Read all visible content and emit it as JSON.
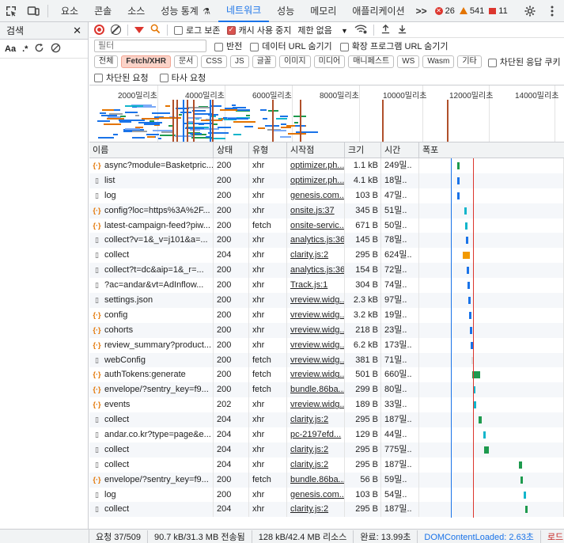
{
  "toolbar": {
    "tabs": [
      "요소",
      "콘솔",
      "소스",
      "성능 통계",
      "네트워크",
      "성능",
      "메모리",
      "애플리케이션"
    ],
    "pin": "⚗",
    "more": ">>",
    "errors": "26",
    "warnings": "541",
    "issues": "11"
  },
  "left": {
    "title": "검색",
    "close": "✕",
    "match_case": "Aa",
    "regex": ".*"
  },
  "net": {
    "preserve_log": "로그 보존",
    "disable_cache": "캐시 사용 중지",
    "throttle": "제한 없음",
    "filter_placeholder": "필터",
    "invert": "반전",
    "hide_data_url": "데이터 URL 숨기기",
    "hide_ext_url": "확장 프로그램 URL 숨기기",
    "chips": [
      "전체",
      "Fetch/XHR",
      "문서",
      "CSS",
      "JS",
      "글꼴",
      "이미지",
      "미디어",
      "매니페스트",
      "WS",
      "Wasm",
      "기타"
    ],
    "blocked_cookies": "차단된 응답 쿠키",
    "blocked_requests": "차단된 요청",
    "third_party": "타사 요청"
  },
  "overview": {
    "ticks": [
      "2000밀리초",
      "4000밀리초",
      "6000밀리초",
      "8000밀리초",
      "10000밀리초",
      "12000밀리초",
      "14000밀리초"
    ]
  },
  "columns": [
    "이름",
    "상태",
    "유형",
    "시작점",
    "크기",
    "시간",
    "폭포"
  ],
  "rows": [
    {
      "name": "async?module=Basketpric...",
      "status": "200",
      "type": "xhr",
      "init": "optimizer.ph...",
      "size": "1.1 kB",
      "time": "249밀..",
      "icon": "xhr",
      "wf_start": 0.26,
      "wf_len": 0.02,
      "wf_color": "#1e9a4e"
    },
    {
      "name": "list",
      "status": "200",
      "type": "xhr",
      "init": "optimizer.ph...",
      "size": "4.1 kB",
      "time": "18밀..",
      "icon": "doc",
      "wf_start": 0.26,
      "wf_len": 0.01,
      "wf_color": "#1a73e8"
    },
    {
      "name": "log",
      "status": "200",
      "type": "xhr",
      "init": "genesis.com...",
      "size": "103 B",
      "time": "47밀..",
      "icon": "doc",
      "wf_start": 0.265,
      "wf_len": 0.012,
      "wf_color": "#1a73e8"
    },
    {
      "name": "config?loc=https%3A%2F...",
      "status": "200",
      "type": "xhr",
      "init": "onsite.js:37",
      "size": "345 B",
      "time": "51밀..",
      "icon": "xhr",
      "wf_start": 0.31,
      "wf_len": 0.012,
      "wf_color": "#12b5cb"
    },
    {
      "name": "latest-campaign-feed?piw...",
      "status": "200",
      "type": "fetch",
      "init": "onsite-servic...",
      "size": "671 B",
      "time": "50밀..",
      "icon": "xhr",
      "wf_start": 0.315,
      "wf_len": 0.012,
      "wf_color": "#12b5cb"
    },
    {
      "name": "collect?v=1&_v=j101&a=...",
      "status": "200",
      "type": "xhr",
      "init": "analytics.js:36",
      "size": "145 B",
      "time": "78밀..",
      "icon": "doc",
      "wf_start": 0.32,
      "wf_len": 0.015,
      "wf_color": "#1a73e8"
    },
    {
      "name": "collect",
      "status": "204",
      "type": "xhr",
      "init": "clarity.js:2",
      "size": "295 B",
      "time": "624밀..",
      "icon": "doc",
      "wf_start": 0.3,
      "wf_len": 0.05,
      "wf_color": "#f29900"
    },
    {
      "name": "collect?t=dc&aip=1&_r=...",
      "status": "200",
      "type": "xhr",
      "init": "analytics.js:36",
      "size": "154 B",
      "time": "72밀..",
      "icon": "doc",
      "wf_start": 0.33,
      "wf_len": 0.014,
      "wf_color": "#1a73e8"
    },
    {
      "name": "?ac=andar&vt=AdInflow...",
      "status": "200",
      "type": "xhr",
      "init": "Track.js:1",
      "size": "304 B",
      "time": "74밀..",
      "icon": "doc",
      "wf_start": 0.335,
      "wf_len": 0.014,
      "wf_color": "#1a73e8"
    },
    {
      "name": "settings.json",
      "status": "200",
      "type": "xhr",
      "init": "vreview.widg...",
      "size": "2.3 kB",
      "time": "97밀..",
      "icon": "doc",
      "wf_start": 0.34,
      "wf_len": 0.015,
      "wf_color": "#1a73e8"
    },
    {
      "name": "config",
      "status": "200",
      "type": "xhr",
      "init": "vreview.widg...",
      "size": "3.2 kB",
      "time": "19밀..",
      "icon": "xhr",
      "wf_start": 0.345,
      "wf_len": 0.01,
      "wf_color": "#1a73e8"
    },
    {
      "name": "cohorts",
      "status": "200",
      "type": "xhr",
      "init": "vreview.widg...",
      "size": "218 B",
      "time": "23밀..",
      "icon": "xhr",
      "wf_start": 0.35,
      "wf_len": 0.01,
      "wf_color": "#1a73e8"
    },
    {
      "name": "review_summary?product...",
      "status": "200",
      "type": "xhr",
      "init": "vreview.widg...",
      "size": "6.2 kB",
      "time": "173밀..",
      "icon": "xhr",
      "wf_start": 0.355,
      "wf_len": 0.02,
      "wf_color": "#1a73e8"
    },
    {
      "name": "webConfig",
      "status": "200",
      "type": "fetch",
      "init": "vreview.widg...",
      "size": "381 B",
      "time": "71밀..",
      "icon": "doc",
      "wf_start": 0.36,
      "wf_len": 0.014,
      "wf_color": "#e0e0e0"
    },
    {
      "name": "authTokens:generate",
      "status": "200",
      "type": "fetch",
      "init": "vreview.widg...",
      "size": "501 B",
      "time": "660밀..",
      "icon": "xhr",
      "wf_start": 0.365,
      "wf_len": 0.055,
      "wf_color": "#1e9a4e"
    },
    {
      "name": "envelope/?sentry_key=f9...",
      "status": "200",
      "type": "fetch",
      "init": "bundle.86ba...",
      "size": "299 B",
      "time": "80밀..",
      "icon": "xhr",
      "wf_start": 0.37,
      "wf_len": 0.015,
      "wf_color": "#12b5cb"
    },
    {
      "name": "events",
      "status": "202",
      "type": "xhr",
      "init": "vreview.widg...",
      "size": "189 B",
      "time": "33밀..",
      "icon": "xhr",
      "wf_start": 0.375,
      "wf_len": 0.01,
      "wf_color": "#12b5cb"
    },
    {
      "name": "collect",
      "status": "204",
      "type": "xhr",
      "init": "clarity.js:2",
      "size": "295 B",
      "time": "187밀..",
      "icon": "doc",
      "wf_start": 0.41,
      "wf_len": 0.02,
      "wf_color": "#1e9a4e"
    },
    {
      "name": "andar.co.kr?type=page&e...",
      "status": "204",
      "type": "xhr",
      "init": "pc-2197efd...",
      "size": "129 B",
      "time": "44밀..",
      "icon": "doc",
      "wf_start": 0.44,
      "wf_len": 0.012,
      "wf_color": "#12b5cb"
    },
    {
      "name": "collect",
      "status": "204",
      "type": "xhr",
      "init": "clarity.js:2",
      "size": "295 B",
      "time": "775밀..",
      "icon": "doc",
      "wf_start": 0.45,
      "wf_len": 0.03,
      "wf_color": "#1e9a4e"
    },
    {
      "name": "collect",
      "status": "204",
      "type": "xhr",
      "init": "clarity.js:2",
      "size": "295 B",
      "time": "187밀..",
      "icon": "doc",
      "wf_start": 0.69,
      "wf_len": 0.02,
      "wf_color": "#1e9a4e"
    },
    {
      "name": "envelope/?sentry_key=f9...",
      "status": "200",
      "type": "fetch",
      "init": "bundle.86ba...",
      "size": "56 B",
      "time": "59밀..",
      "icon": "xhr",
      "wf_start": 0.7,
      "wf_len": 0.012,
      "wf_color": "#1e9a4e"
    },
    {
      "name": "log",
      "status": "200",
      "type": "xhr",
      "init": "genesis.com...",
      "size": "103 B",
      "time": "54밀..",
      "icon": "doc",
      "wf_start": 0.72,
      "wf_len": 0.014,
      "wf_color": "#12b5cb"
    },
    {
      "name": "collect",
      "status": "204",
      "type": "xhr",
      "init": "clarity.js:2",
      "size": "295 B",
      "time": "187밀..",
      "icon": "doc",
      "wf_start": 0.73,
      "wf_len": 0.02,
      "wf_color": "#1e9a4e"
    }
  ],
  "status": {
    "requests": "요청 37/509",
    "transferred": "90.7 kB/31.3 MB 전송됨",
    "resources": "128 kB/42.4 MB 리소스",
    "finish": "완료: 13.99초",
    "dcl": "DOMContentLoaded: 2.63초",
    "load": "로드: "
  },
  "colors": {
    "accent": "#1a73e8",
    "record": "#dc362e",
    "dcl_line": "#1a73e8",
    "load_line": "#dc362e"
  }
}
